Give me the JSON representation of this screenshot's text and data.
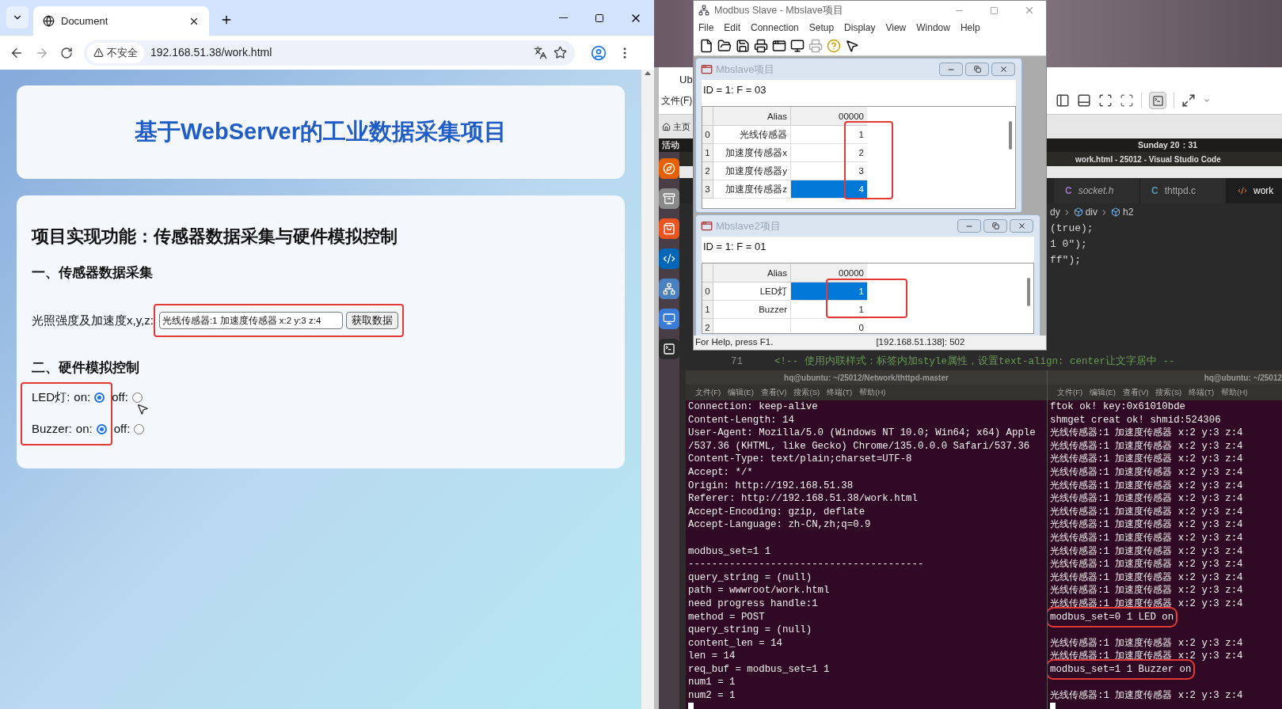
{
  "browser": {
    "tab_title": "Document",
    "security_chip": "不安全",
    "url": "192.168.51.38/work.html"
  },
  "page": {
    "title": "基于WebServer的工业数据采集项目",
    "heading": "项目实现功能：传感器数据采集与硬件模拟控制",
    "section_1": "一、传感器数据采集",
    "data_label": "光照强度及加速度x,y,z:",
    "data_field": {
      "value": "光线传感器:1 加速度传感器 x:2 y:3 z:4"
    },
    "fetch_button": "获取数据",
    "section_2": "二、硬件模拟控制",
    "controls": [
      {
        "label": "LED灯:",
        "options": [
          {
            "label": "on:",
            "selected": true
          },
          {
            "label": "off:",
            "selected": false
          }
        ]
      },
      {
        "label": "Buzzer:",
        "options": [
          {
            "label": "on:",
            "selected": true
          },
          {
            "label": "off:",
            "selected": false
          }
        ]
      }
    ]
  },
  "vm": {
    "tab_partial": "Ub",
    "menu_partial": "文件(F)",
    "home_tab": "主页"
  },
  "ubuntu": {
    "activities": "活动",
    "clock": "Sunday 20：31"
  },
  "vscode": {
    "title": "work.html - 25012 - Visual Studio Code",
    "tabs": [
      {
        "kind": "c",
        "icon": "C",
        "label": "socket.h",
        "preview": true,
        "selected": false
      },
      {
        "kind": "c",
        "icon": "C",
        "label": "thttpd.c",
        "preview": false,
        "selected": false
      },
      {
        "kind": "html",
        "label": "work",
        "preview": false,
        "selected": true
      }
    ],
    "breadcrumb": [
      {
        "kind": "text",
        "label": "dy"
      },
      {
        "kind": "element",
        "label": "div"
      },
      {
        "kind": "element",
        "label": "h2"
      }
    ],
    "code_lines": [
      "(true);",
      "1 0\");",
      "ff\");"
    ],
    "comment_line": {
      "number": "71",
      "text": "<!-- 使用内联样式：标签内加style属性，设置text-align: center让文字居中 --"
    }
  },
  "modbus": {
    "title": "Modbus Slave - Mbslave项目",
    "menu": [
      "File",
      "Edit",
      "Connection",
      "Setup",
      "Display",
      "View",
      "Window",
      "Help"
    ],
    "windows": [
      {
        "title": "Mbslave项目",
        "info": "ID = 1: F = 03",
        "alias_header": "Alias",
        "value_header": "00000",
        "rows": [
          {
            "index": "0",
            "alias": "光线传感器",
            "value": "1",
            "selected": false
          },
          {
            "index": "1",
            "alias": "加速度传感器x",
            "value": "2",
            "selected": false
          },
          {
            "index": "2",
            "alias": "加速度传感器y",
            "value": "3",
            "selected": false
          },
          {
            "index": "3",
            "alias": "加速度传感器z",
            "value": "4",
            "selected": true
          }
        ]
      },
      {
        "title": "Mbslave2项目",
        "info": "ID = 1: F = 01",
        "alias_header": "Alias",
        "value_header": "00000",
        "rows": [
          {
            "index": "0",
            "alias": "LED灯",
            "value": "1",
            "selected": true
          },
          {
            "index": "1",
            "alias": "Buzzer",
            "value": "1",
            "selected": false
          },
          {
            "index": "2",
            "value": "0",
            "selected": false
          }
        ]
      }
    ],
    "status_left": "For Help, press F1.",
    "status_right": "[192.168.51.138]: 502"
  },
  "terminal_left": {
    "title": "hq@ubuntu: ~/25012/Network/thttpd-master",
    "menu": [
      "文件(F)",
      "编辑(E)",
      "查看(V)",
      "搜索(S)",
      "终端(T)",
      "帮助(H)"
    ],
    "lines": [
      {
        "text": "Connection: keep-alive"
      },
      {
        "text": "Content-Length: 14"
      },
      {
        "text": "User-Agent: Mozilla/5.0 (Windows NT 10.0; Win64; x64) Apple"
      },
      {
        "text": "/537.36 (KHTML, like Gecko) Chrome/135.0.0.0 Safari/537.36"
      },
      {
        "text": "Content-Type: text/plain;charset=UTF-8"
      },
      {
        "text": "Accept: */*"
      },
      {
        "text": "Origin: http://192.168.51.38"
      },
      {
        "text": "Referer: http://192.168.51.38/work.html"
      },
      {
        "text": "Accept-Encoding: gzip, deflate"
      },
      {
        "text": "Accept-Language: zh-CN,zh;q=0.9"
      },
      {
        "text": "modbus_set=1 1",
        "gap_before": true
      },
      {
        "text": "----------------------------------------"
      },
      {
        "text": "query_string = (null)"
      },
      {
        "text": "path = wwwroot/work.html"
      },
      {
        "text": "need progress handle:1"
      },
      {
        "text": "method = POST"
      },
      {
        "text": "query_string = (null)"
      },
      {
        "text": "content_len = 14"
      },
      {
        "text": "len = 14"
      },
      {
        "text": "req_buf = modbus_set=1 1"
      },
      {
        "text": "num1 = 1"
      },
      {
        "text": "num2 = 1"
      }
    ]
  },
  "terminal_right": {
    "title": "hq@ubuntu: ~/25012",
    "menu": [
      "文件(F)",
      "编辑(E)",
      "查看(V)",
      "搜索(S)",
      "终端(T)",
      "帮助(H)"
    ],
    "lines": [
      {
        "text": "ftok ok! key:0x61010bde"
      },
      {
        "text": "shmget creat ok! shmid:524306"
      },
      {
        "text": "光线传感器:1 加速度传感器 x:2 y:3 z:4"
      },
      {
        "text": "光线传感器:1 加速度传感器 x:2 y:3 z:4"
      },
      {
        "text": "光线传感器:1 加速度传感器 x:2 y:3 z:4"
      },
      {
        "text": "光线传感器:1 加速度传感器 x:2 y:3 z:4"
      },
      {
        "text": "光线传感器:1 加速度传感器 x:2 y:3 z:4"
      },
      {
        "text": "光线传感器:1 加速度传感器 x:2 y:3 z:4"
      },
      {
        "text": "光线传感器:1 加速度传感器 x:2 y:3 z:4"
      },
      {
        "text": "光线传感器:1 加速度传感器 x:2 y:3 z:4"
      },
      {
        "text": "光线传感器:1 加速度传感器 x:2 y:3 z:4"
      },
      {
        "text": "光线传感器:1 加速度传感器 x:2 y:3 z:4"
      },
      {
        "text": "光线传感器:1 加速度传感器 x:2 y:3 z:4"
      },
      {
        "text": "光线传感器:1 加速度传感器 x:2 y:3 z:4"
      },
      {
        "text": "光线传感器:1 加速度传感器 x:2 y:3 z:4"
      },
      {
        "text": "光线传感器:1 加速度传感器 x:2 y:3 z:4"
      },
      {
        "text": "modbus_set=0 1 LED on",
        "highlighted": true
      },
      {
        "text": "光线传感器:1 加速度传感器 x:2 y:3 z:4",
        "gap_before": true
      },
      {
        "text": "光线传感器:1 加速度传感器 x:2 y:3 z:4"
      },
      {
        "text": "modbus_set=1 1 Buzzer on",
        "highlighted": true
      },
      {
        "text": "光线传感器:1 加速度传感器 x:2 y:3 z:4",
        "gap_before": true
      }
    ]
  }
}
